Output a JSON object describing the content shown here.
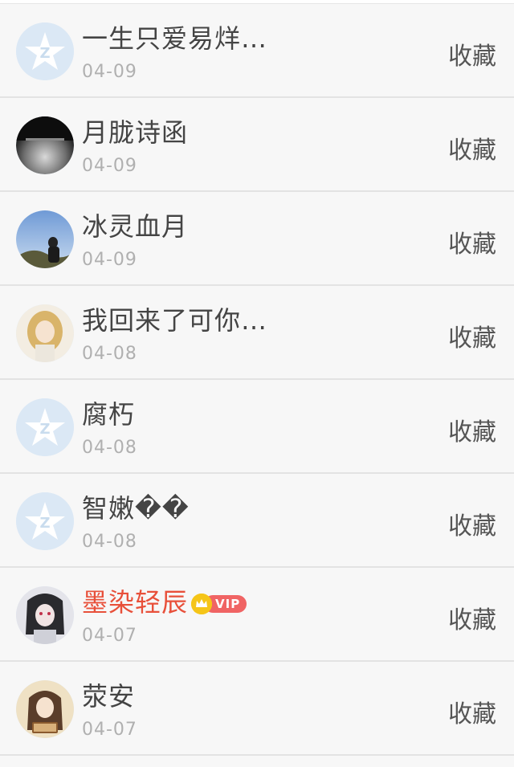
{
  "action_label": "收藏",
  "items": [
    {
      "name": "一生只爱易烊…",
      "date": "04-09",
      "avatar": "default-qzone-avatar",
      "vip": false
    },
    {
      "name": "月胧诗函",
      "date": "04-09",
      "avatar": "misty-landscape-avatar",
      "vip": false
    },
    {
      "name": "冰灵血月",
      "date": "04-09",
      "avatar": "sky-silhouette-avatar",
      "vip": false
    },
    {
      "name": "我回来了可你…",
      "date": "04-08",
      "avatar": "anime-girl-blonde-avatar",
      "vip": false
    },
    {
      "name": "腐朽",
      "date": "04-08",
      "avatar": "default-qzone-avatar",
      "vip": false
    },
    {
      "name": "智嫩��",
      "date": "04-08",
      "avatar": "default-qzone-avatar",
      "vip": false
    },
    {
      "name": "墨染轻辰",
      "date": "04-07",
      "avatar": "anime-girl-dark-avatar",
      "vip": true,
      "vip_label": "VIP"
    },
    {
      "name": "荥安",
      "date": "04-07",
      "avatar": "anime-girl-book-avatar",
      "vip": false
    }
  ],
  "colors": {
    "vip_name": "#e8503a",
    "vip_badge": "#f06464",
    "crown": "#f5c518"
  }
}
